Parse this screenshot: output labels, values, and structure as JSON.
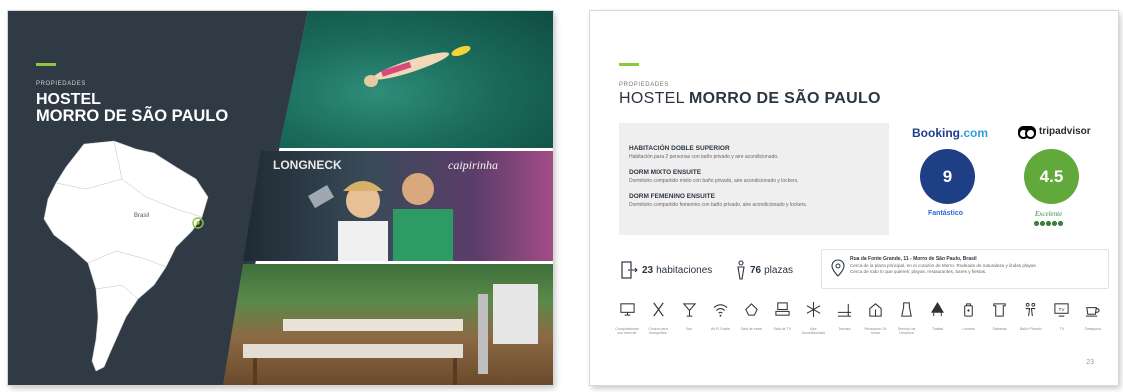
{
  "left_page": {
    "eyebrow": "PROPIEDADES",
    "title_line1": "HOSTEL",
    "title_line2": "MORRO DE SÃO PAULO",
    "map_label": "Brasil"
  },
  "right_page": {
    "eyebrow": "PROPIEDADES",
    "title_prefix": "HOSTEL",
    "title_bold": "MORRO DE SÃO PAULO",
    "rooms": [
      {
        "name": "HABITACIÓN DOBLE SUPERIOR",
        "desc": "Habitación para 2 personas con baño privado y aire acondicionado."
      },
      {
        "name": "DORM MIXTO ENSUITE",
        "desc": "Dormitorio compartido mixto con baño privado, aire acondicionado y lockers."
      },
      {
        "name": "DORM FEMENINO ENSUITE",
        "desc": "Dormitorio compartido femenino con baño privado, aire acondicionado y lockers."
      }
    ],
    "booking": {
      "brand": "Booking",
      "brand_suffix": ".com",
      "score": "9",
      "label": "Fantástico"
    },
    "tripadvisor": {
      "brand": "tripadvisor",
      "score": "4.5",
      "label": "Excelente",
      "bubbles": 5
    },
    "stats": {
      "rooms_count": "23",
      "rooms_label": "habitaciones",
      "beds_count": "76",
      "beds_label": "plazas"
    },
    "address": {
      "title": "Rua da Fonte Grande, 11 - Morro de São Paulo, Brasil",
      "line1": "Cerca de la plaza principal, en el corazón de Morro. Rodeado de naturaleza y lindas playas.",
      "line2": "Cerca de todo lo que quieres: playas, restaurantes, bares y fiestas."
    },
    "amenities": [
      {
        "icon": "computer-icon",
        "label": "Computadores con Internet"
      },
      {
        "icon": "kitchen-icon",
        "label": "Cocina para huéspedes"
      },
      {
        "icon": "bar-icon",
        "label": "Bar"
      },
      {
        "icon": "wifi-icon",
        "label": "Wi-Fi Gratis"
      },
      {
        "icon": "lounge-icon",
        "label": "Sala de estar"
      },
      {
        "icon": "tv-room-icon",
        "label": "Sala de TV"
      },
      {
        "icon": "ac-icon",
        "label": "Aire Acondicionado"
      },
      {
        "icon": "terrace-icon",
        "label": "Terraza"
      },
      {
        "icon": "reception-icon",
        "label": "Recepción 24 horas"
      },
      {
        "icon": "cleaning-icon",
        "label": "Servicio de Limpieza"
      },
      {
        "icon": "towels-icon",
        "label": "Toallas"
      },
      {
        "icon": "lockers-icon",
        "label": "Lockers"
      },
      {
        "icon": "sheets-icon",
        "label": "Sábanas"
      },
      {
        "icon": "bathroom-icon",
        "label": "Baño Privado"
      },
      {
        "icon": "tv-icon",
        "label": "TV"
      },
      {
        "icon": "breakfast-icon",
        "label": "Desayuno"
      }
    ],
    "page_number": "23"
  },
  "colors": {
    "accent": "#8dc63f",
    "dark_panel": "#2f3a44",
    "booking_blue": "#1e3f86",
    "trip_green": "#62a93b"
  }
}
